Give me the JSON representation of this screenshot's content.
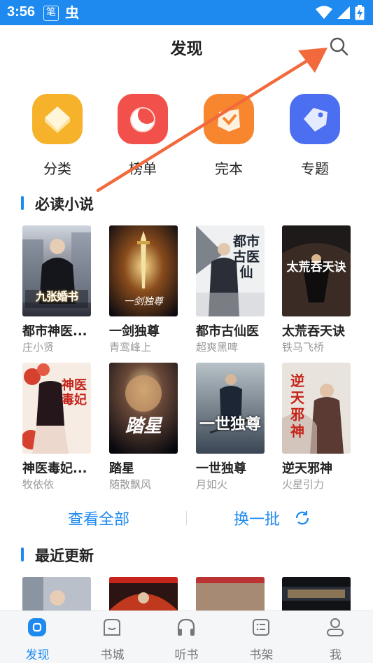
{
  "status_bar": {
    "time": "3:56",
    "badge_1": "笔",
    "badge_2": "虫",
    "battery_icon": "battery-charging-icon",
    "signal_icon": "signal-icon",
    "wifi_icon": "wifi-icon"
  },
  "header": {
    "title": "发现",
    "search_icon": "search-icon"
  },
  "categories": [
    {
      "label": "分类",
      "icon": "category-icon",
      "color": "#f5b22a"
    },
    {
      "label": "榜单",
      "icon": "ranking-icon",
      "color": "#f2504a"
    },
    {
      "label": "完本",
      "icon": "finished-icon",
      "color": "#f7862f"
    },
    {
      "label": "专题",
      "icon": "topic-icon",
      "color": "#4c6ef0"
    }
  ],
  "must_read": {
    "title": "必读小说",
    "books": [
      {
        "title": "都市神医...",
        "author": "庄小贤",
        "cover_text": "九张婚书"
      },
      {
        "title": "一剑独尊",
        "author": "青鸾峰上",
        "cover_text": "一剑独尊"
      },
      {
        "title": "都市古仙医",
        "author": "超爽黑啤",
        "cover_text": "都市古医仙"
      },
      {
        "title": "太荒吞天诀",
        "author": "铁马飞桥",
        "cover_text": "太荒吞天诀"
      },
      {
        "title": "神医毒妃...",
        "author": "牧依依",
        "cover_text": "神医毒妃"
      },
      {
        "title": "踏星",
        "author": "随散飘风",
        "cover_text": "踏星"
      },
      {
        "title": "一世独尊",
        "author": "月如火",
        "cover_text": "一世独尊"
      },
      {
        "title": "逆天邪神",
        "author": "火星引力",
        "cover_text": "逆天邪神"
      }
    ],
    "view_all": "查看全部",
    "refresh": "换一批"
  },
  "recent": {
    "title": "最近更新",
    "covers": [
      "cover-1",
      "cover-2",
      "cover-3",
      "cover-4"
    ]
  },
  "bottom_nav": [
    {
      "label": "发现",
      "icon": "discover-icon",
      "active": true
    },
    {
      "label": "书城",
      "icon": "bookstore-icon",
      "active": false
    },
    {
      "label": "听书",
      "icon": "headphones-icon",
      "active": false
    },
    {
      "label": "书架",
      "icon": "bookshelf-icon",
      "active": false
    },
    {
      "label": "我",
      "icon": "profile-icon",
      "active": false
    }
  ],
  "colors": {
    "accent": "#1e8af0",
    "annotation_arrow": "#f26a3c"
  }
}
